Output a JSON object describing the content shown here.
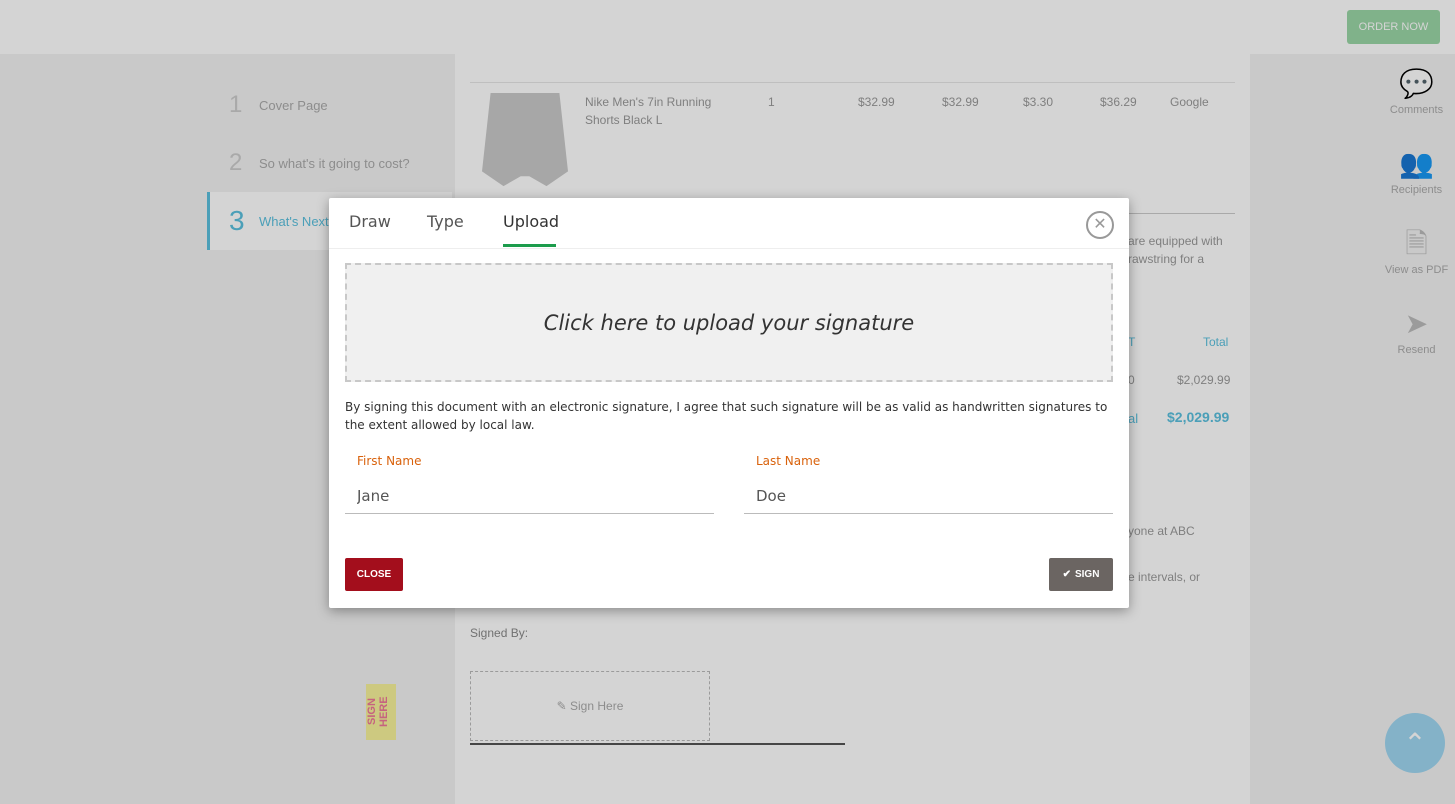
{
  "topbar": {
    "order_label": "ORDER NOW"
  },
  "leftnav": {
    "items": [
      {
        "num": "1",
        "label": "Cover Page"
      },
      {
        "num": "2",
        "label": "So what's it going to cost?"
      },
      {
        "num": "3",
        "label": "What's Next"
      }
    ]
  },
  "document": {
    "product": {
      "name": "Nike Men's 7in Running Shorts Black L",
      "qty": "1",
      "price": "$32.99",
      "subtotal": "$32.99",
      "tax": "$3.30",
      "total": "$36.29",
      "vendor": "Google"
    },
    "partial_texts": {
      "desc1": "are equipped with",
      "desc2": "rawstring for a",
      "total_header": "Total",
      "t_header_partial": "T",
      "row_total_partial": "0",
      "row_total": "$2,029.99",
      "grand_label_partial": "al",
      "grand_total": "$2,029.99",
      "body1": "yone at ABC",
      "body2": "e intervals, or"
    },
    "signed_by": "Signed By:",
    "sign_here": "Sign Here",
    "sign_tag": "SIGN HERE"
  },
  "sidebar": {
    "items": [
      {
        "icon": "comments-icon",
        "label": "Comments"
      },
      {
        "icon": "recipients-icon",
        "label": "Recipients"
      },
      {
        "icon": "pdf-icon",
        "label": "View as PDF"
      },
      {
        "icon": "resend-icon",
        "label": "Resend"
      }
    ]
  },
  "modal": {
    "tabs": [
      "Draw",
      "Type",
      "Upload"
    ],
    "active_tab": "Upload",
    "upload_prompt": "Click here to upload your signature",
    "disclaimer": "By signing this document with an electronic signature, I agree that such signature will be as valid as handwritten signatures to the extent allowed by local law.",
    "first_name_label": "First Name",
    "first_name_value": "Jane",
    "last_name_label": "Last Name",
    "last_name_value": "Doe",
    "close_label": "CLOSE",
    "sign_label": "SIGN"
  },
  "colors": {
    "accent_green": "#1c9c4c",
    "close_red": "#a30e1c",
    "label_orange": "#d9620c",
    "sign_grey": "#6b6562"
  }
}
